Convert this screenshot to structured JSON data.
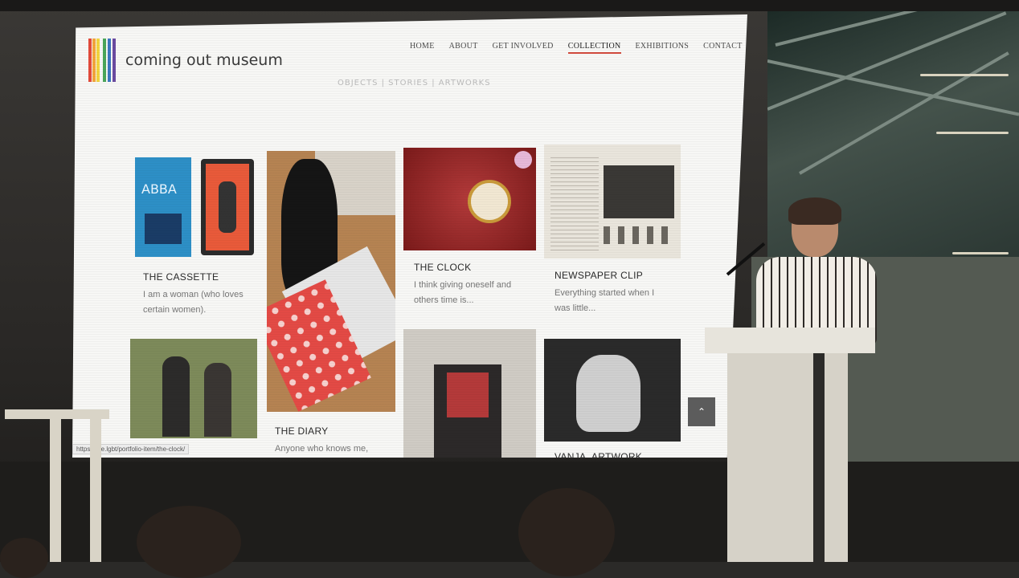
{
  "site": {
    "logo_text": "coming out museum",
    "logo_colors": [
      "#e24a3a",
      "#f3a43b",
      "#f2d43f",
      "#4aa65a",
      "#3c78c0",
      "#6a4aa0"
    ],
    "nav": [
      "HOME",
      "ABOUT",
      "GET INVOLVED",
      "COLLECTION",
      "EXHIBITIONS",
      "CONTACT"
    ],
    "active_nav": "COLLECTION",
    "subnav": "OBJECTS | STORIES | ARTWORKS"
  },
  "collection": {
    "items": [
      {
        "title": "THE CASSETTE",
        "excerpt": "I am a woman (who loves certain women)."
      },
      {
        "title": "THE CLOCK",
        "excerpt": "I think giving oneself and others time is..."
      },
      {
        "title": "NEWSPAPER CLIP",
        "excerpt": "Everything started when I was little..."
      },
      {
        "title": "THE DIARY",
        "excerpt": "Anyone who knows me,"
      },
      {
        "title": "VANJA, ARTWORK",
        "excerpt": ""
      }
    ],
    "album_text": "ABBA",
    "status_url": "https://...e.lgbt/portfolio-item/the-clock/",
    "back_to_top": "⌃"
  },
  "colors": {
    "accent_underline": "#d34a3d",
    "screen_bg": "#f7f7f5"
  }
}
